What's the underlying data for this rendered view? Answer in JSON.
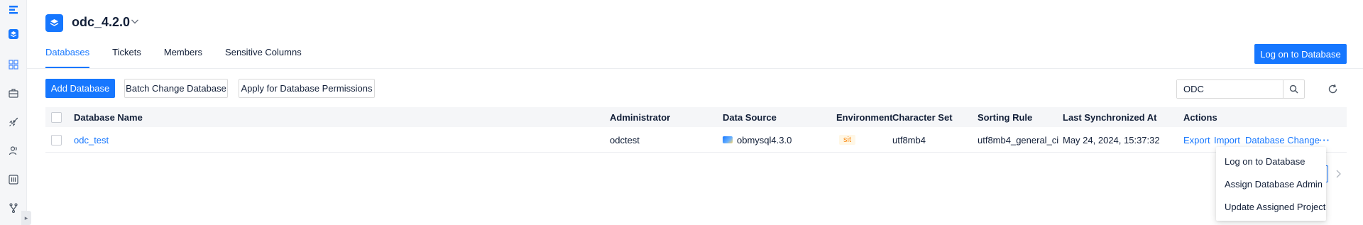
{
  "project": {
    "name": "odc_4.2.0"
  },
  "tabs": [
    {
      "label": "Databases",
      "active": true
    },
    {
      "label": "Tickets",
      "active": false
    },
    {
      "label": "Members",
      "active": false
    },
    {
      "label": "Sensitive Columns",
      "active": false
    }
  ],
  "header": {
    "logon_button": "Log on to Database"
  },
  "toolbar": {
    "add_database": "Add Database",
    "batch_change": "Batch Change Database",
    "apply_permissions": "Apply for Database Permissions",
    "search_value": "ODC"
  },
  "table": {
    "columns": [
      "Database Name",
      "Administrator",
      "Data Source",
      "Environment",
      "Character Set",
      "Sorting Rule",
      "Last Synchronized At",
      "Actions"
    ],
    "rows": [
      {
        "database_name": "odc_test",
        "administrator": "odctest",
        "data_source": "obmysql4.3.0",
        "environment": "sit",
        "character_set": "utf8mb4",
        "sorting_rule": "utf8mb4_general_ci",
        "last_synced": "May 24, 2024, 15:37:32",
        "actions": [
          "Export",
          "Import",
          "Database Change",
          "···"
        ]
      }
    ]
  },
  "action_menu": {
    "items": [
      "Log on to Database",
      "Assign Database Admin",
      "Update Assigned Project"
    ]
  },
  "colors": {
    "primary": "#1677ff",
    "env_tag_text": "#fa8c16",
    "env_tag_bg": "#fff7e6"
  }
}
